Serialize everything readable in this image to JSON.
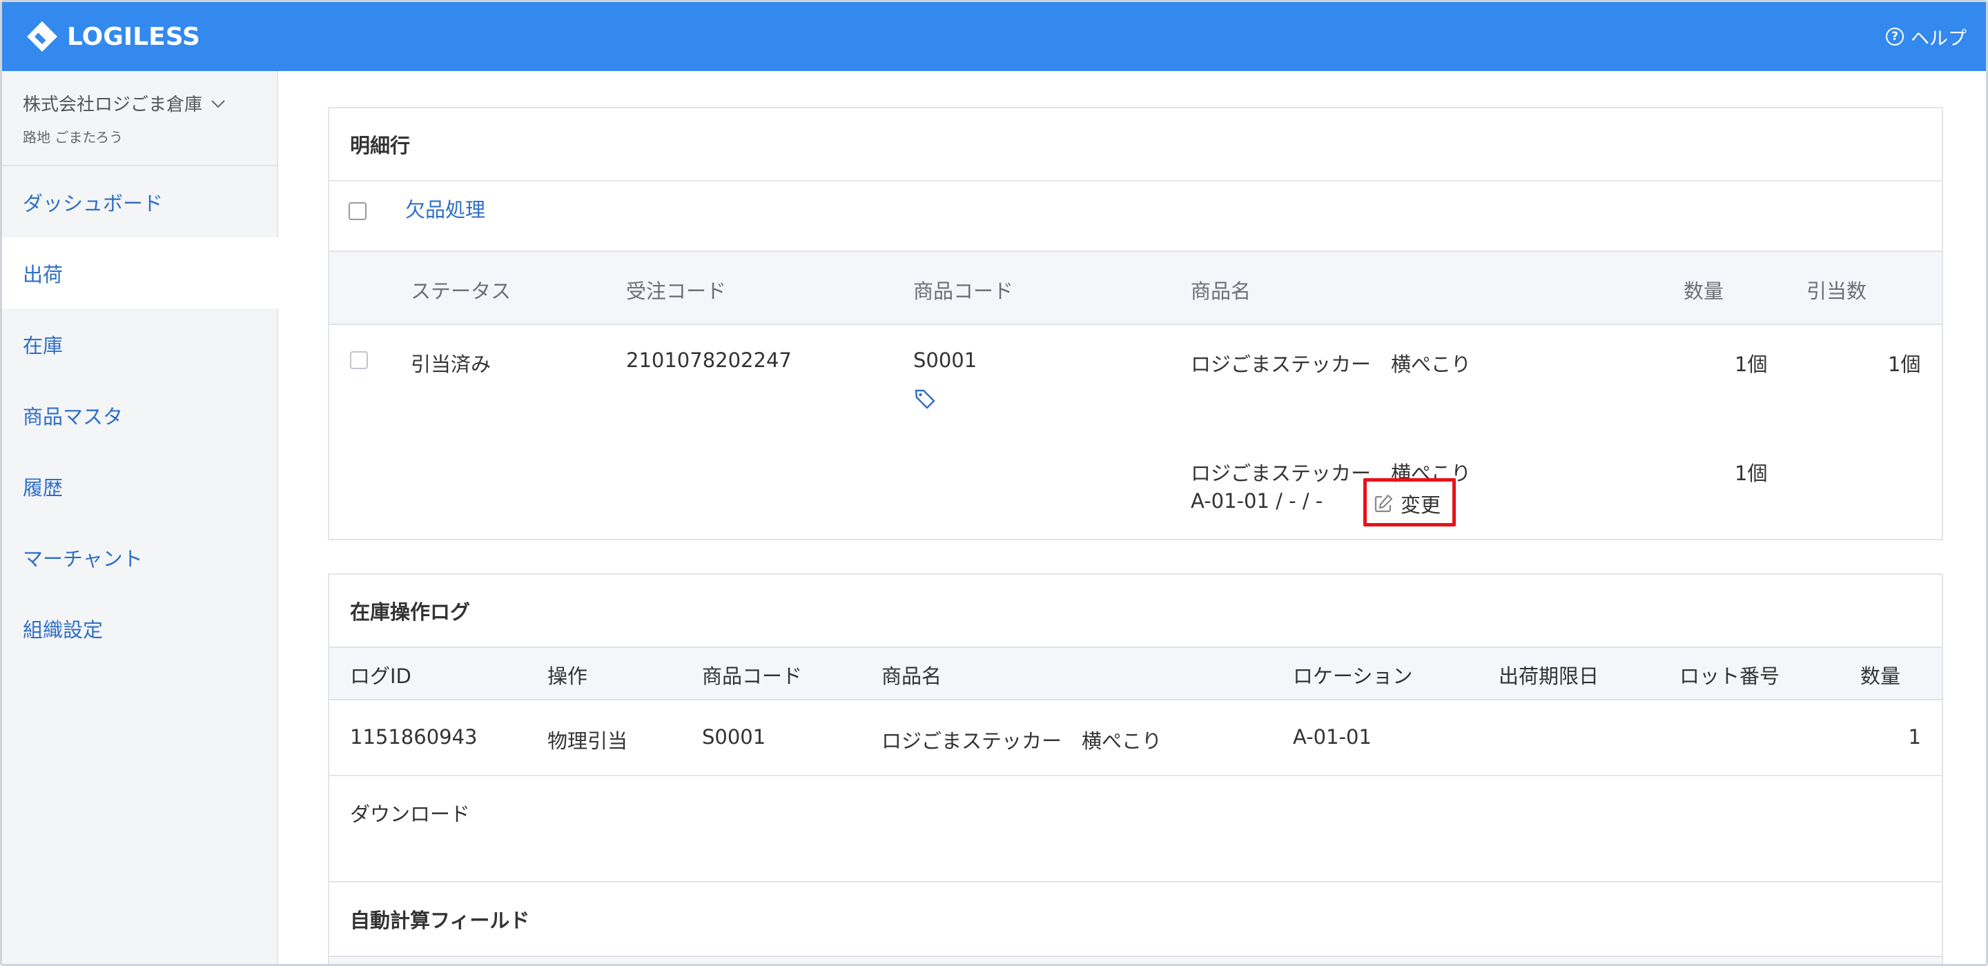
{
  "header": {
    "logo_text": "LOGILESS",
    "help_label": "ヘルプ",
    "color": "#3389ee"
  },
  "sidebar": {
    "org_name": "株式会社ロジごま倉庫",
    "user_name": "路地 ごまたろう",
    "items": [
      {
        "label": "ダッシュボード"
      },
      {
        "label": "出荷"
      },
      {
        "label": "在庫"
      },
      {
        "label": "商品マスタ"
      },
      {
        "label": "履歴"
      },
      {
        "label": "マーチャント"
      },
      {
        "label": "組織設定"
      }
    ]
  },
  "lines_card": {
    "title": "明細行",
    "shortage_label": "欠品処理",
    "columns": [
      "ステータス",
      "受注コード",
      "商品コード",
      "商品名",
      "数量",
      "引当数"
    ],
    "row": {
      "status": "引当済み",
      "order_code": "2101078202247",
      "product_code": "S0001",
      "product_name": "ロジごまステッカー　横ぺこり",
      "quantity": "1個",
      "allocated": "1個"
    },
    "sub_row": {
      "product_name": "ロジごまステッカー　横ぺこり",
      "quantity": "1個",
      "location": "A-01-01 / - / -",
      "change_label": "変更"
    }
  },
  "log_card": {
    "title": "在庫操作ログ",
    "columns": [
      "ログID",
      "操作",
      "商品コード",
      "商品名",
      "ロケーション",
      "出荷期限日",
      "ロット番号",
      "数量"
    ],
    "rows": [
      {
        "log_id": "1151860943",
        "operation": "物理引当",
        "product_code": "S0001",
        "product_name": "ロジごまステッカー　横ぺこり",
        "location": "A-01-01",
        "expiry": "",
        "lot": "",
        "quantity": "1"
      }
    ],
    "download_label": "ダウンロード"
  },
  "auto_card": {
    "title": "自動計算フィールド"
  }
}
